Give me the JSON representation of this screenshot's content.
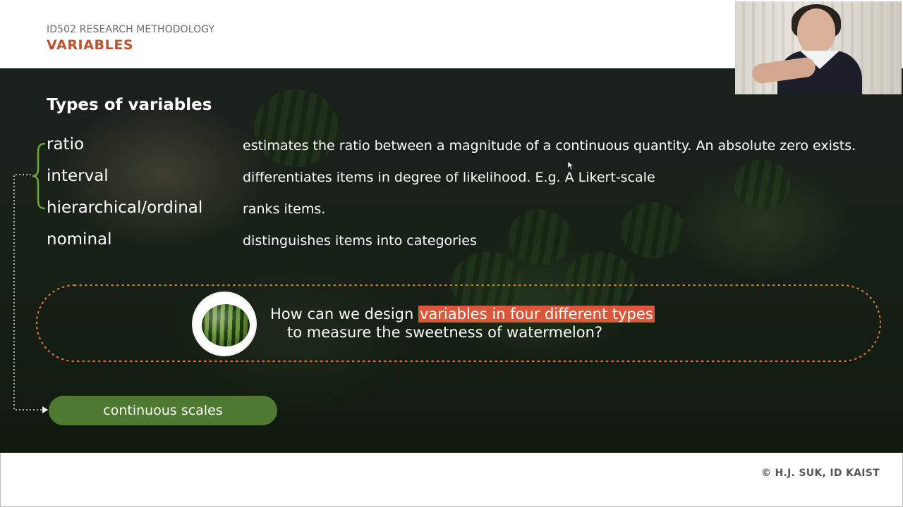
{
  "header": {
    "course": "ID502 RESEARCH METHODOLOGY",
    "title": "VARIABLES"
  },
  "main": {
    "heading": "Types of variables",
    "types": [
      {
        "name": "ratio",
        "description": "estimates the ratio between a magnitude of a continuous quantity. An absolute zero exists."
      },
      {
        "name": "interval",
        "description": "differentiates items in degree of likelihood. E.g. A Likert-scale"
      },
      {
        "name": "hierarchical/ordinal",
        "description": "ranks items."
      },
      {
        "name": "nominal",
        "description": "distinguishes items into categories"
      }
    ],
    "question": {
      "prefix": "How can we design ",
      "highlight": "variables in four different types",
      "line2": "to measure the sweetness of watermelon?"
    },
    "pill_label": "continuous scales"
  },
  "footer": {
    "copyright": "© H.J. SUK, ID KAIST"
  },
  "colors": {
    "title_accent": "#c0522f",
    "highlight": "#d9583a",
    "pill_green": "#4d7a30",
    "dot_orange": "#e0703d"
  }
}
